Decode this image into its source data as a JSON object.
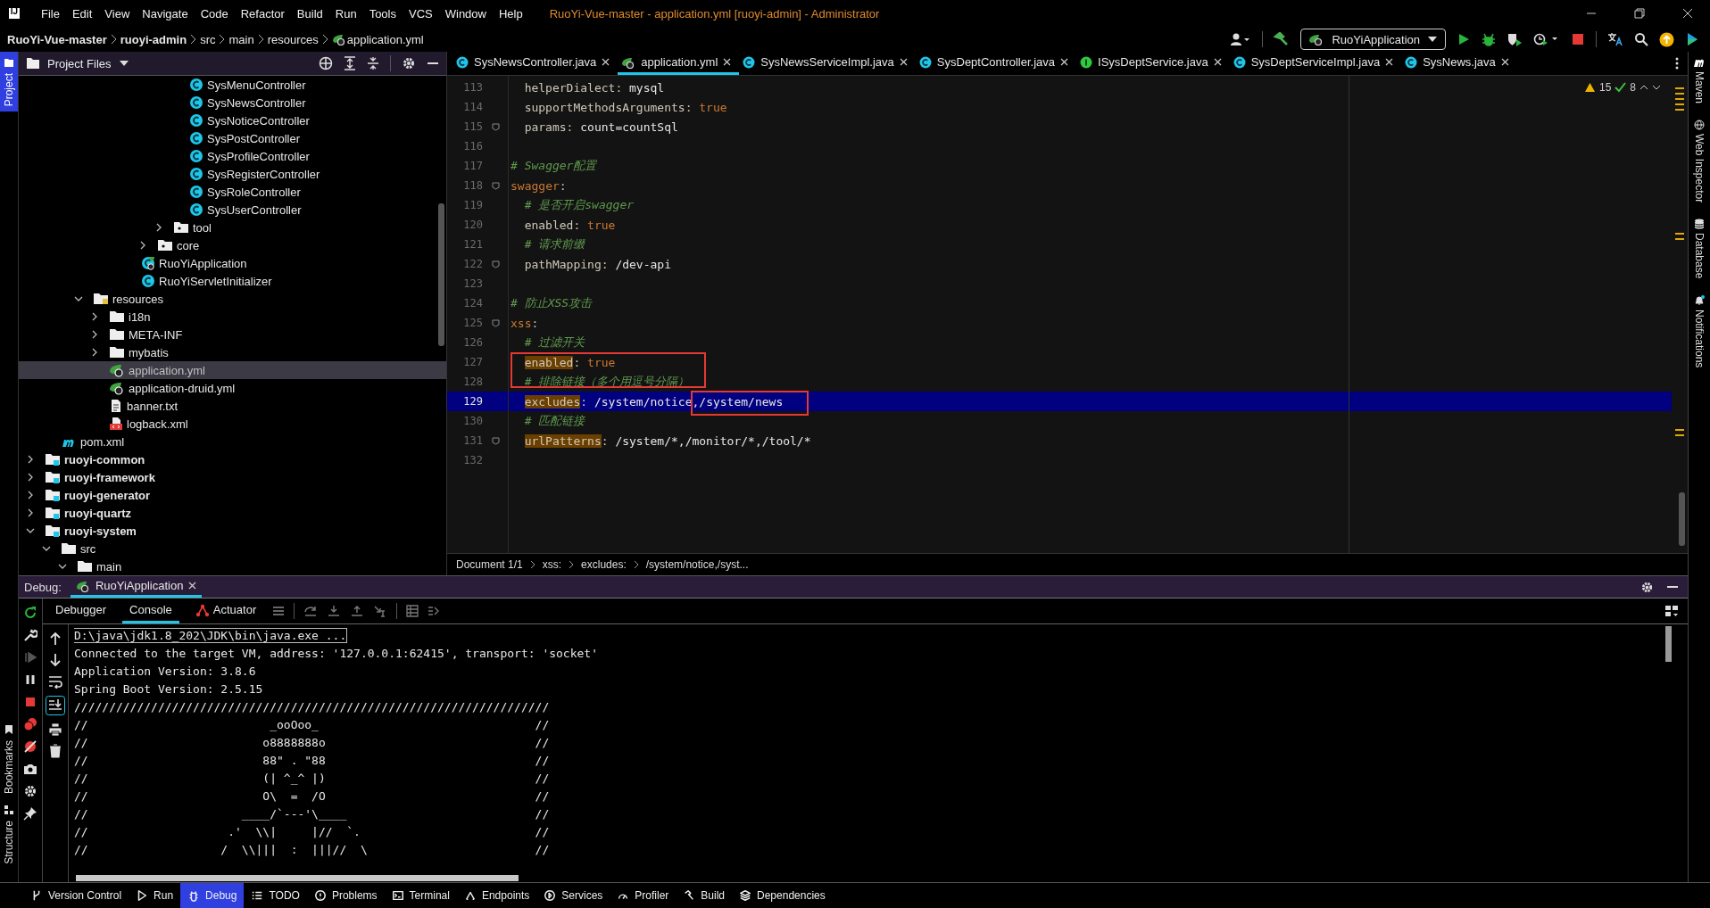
{
  "window": {
    "logo": "IJ",
    "title": "RuoYi-Vue-master - application.yml [ruoyi-admin] - Administrator"
  },
  "menu": [
    "File",
    "Edit",
    "View",
    "Navigate",
    "Code",
    "Refactor",
    "Build",
    "Run",
    "Tools",
    "VCS",
    "Window",
    "Help"
  ],
  "breadcrumbs": [
    {
      "label": "RuoYi-Vue-master",
      "kind": "project"
    },
    {
      "label": "ruoyi-admin",
      "kind": "project"
    },
    {
      "label": "src",
      "kind": "folder"
    },
    {
      "label": "main",
      "kind": "folder"
    },
    {
      "label": "resources",
      "kind": "folder"
    },
    {
      "label": "application.yml",
      "kind": "yml"
    }
  ],
  "run_config": "RuoYiApplication",
  "side_left": [
    {
      "label": "Project",
      "selected": true
    },
    {
      "label": "Bookmarks",
      "selected": false
    },
    {
      "label": "Structure",
      "selected": false
    }
  ],
  "side_right": [
    "Maven",
    "Web Inspector",
    "Database",
    "Notifications"
  ],
  "project_panel": {
    "title": "Project Files"
  },
  "tree": [
    {
      "children": [
        {
          "children": [
            {
              "children": [
                {
                  "children": [
                    {
                      "children": [
                        {
                          "children": [
                            {
                              "children": [
                                {
                                  "children": [
                                    {
                                      "children": [
                                        {
                                          "label": "SysMenuController",
                                          "kind": "class",
                                          "selected": false
                                        },
                                        {
                                          "label": "SysNewsController",
                                          "kind": "class",
                                          "selected": false
                                        },
                                        {
                                          "label": "SysNoticeController",
                                          "kind": "class",
                                          "selected": false
                                        },
                                        {
                                          "label": "SysPostController",
                                          "kind": "class",
                                          "selected": false
                                        },
                                        {
                                          "label": "SysProfileController",
                                          "kind": "class",
                                          "selected": false
                                        },
                                        {
                                          "label": "SysRegisterController",
                                          "kind": "class",
                                          "selected": false
                                        },
                                        {
                                          "label": "SysRoleController",
                                          "kind": "class",
                                          "selected": false
                                        },
                                        {
                                          "label": "SysUserController",
                                          "kind": "class",
                                          "selected": false
                                        }
                                      ]
                                    },
                                    {
                                      "label": "tool",
                                      "kind": "folder",
                                      "expanded": false,
                                      "selected": false
                                    }
                                  ]
                                },
                                {
                                  "label": "core",
                                  "kind": "folder",
                                  "expanded": false,
                                  "selected": false
                                }
                              ]
                            },
                            {
                              "label": "RuoYiApplication",
                              "kind": "app-class",
                              "selected": false
                            },
                            {
                              "label": "RuoYiServletInitializer",
                              "kind": "class",
                              "selected": false
                            }
                          ]
                        }
                      ]
                    }
                  ]
                },
                {
                  "label": "resources",
                  "kind": "resource-folder",
                  "expanded": true,
                  "selected": false,
                  "children": [
                    {
                      "label": "i18n",
                      "kind": "folder",
                      "expanded": false,
                      "selected": false
                    },
                    {
                      "label": "META-INF",
                      "kind": "folder",
                      "expanded": false,
                      "selected": false
                    },
                    {
                      "label": "mybatis",
                      "kind": "folder",
                      "expanded": false,
                      "selected": false
                    },
                    {
                      "label": "application.yml",
                      "kind": "yml",
                      "selected": true
                    },
                    {
                      "label": "application-druid.yml",
                      "kind": "yml",
                      "selected": false
                    },
                    {
                      "label": "banner.txt",
                      "kind": "text",
                      "selected": false
                    },
                    {
                      "label": "logback.xml",
                      "kind": "xml",
                      "selected": false
                    }
                  ]
                }
              ]
            }
          ]
        },
        {
          "label": "pom.xml",
          "kind": "maven",
          "selected": false
        }
      ]
    },
    {
      "label": "ruoyi-common",
      "kind": "module",
      "expanded": false,
      "selected": false
    },
    {
      "label": "ruoyi-framework",
      "kind": "module",
      "expanded": false,
      "selected": false
    },
    {
      "label": "ruoyi-generator",
      "kind": "module",
      "expanded": false,
      "selected": false
    },
    {
      "label": "ruoyi-quartz",
      "kind": "module",
      "expanded": false,
      "selected": false
    },
    {
      "label": "ruoyi-system",
      "kind": "module",
      "expanded": true,
      "selected": false,
      "children": [
        {
          "label": "src",
          "kind": "folder",
          "expanded": true,
          "selected": false,
          "children": [
            {
              "label": "main",
              "kind": "folder",
              "expanded": true,
              "selected": false
            }
          ]
        }
      ]
    }
  ],
  "editor_tabs": [
    {
      "label": "SysNewsController.java",
      "kind": "class",
      "selected": false
    },
    {
      "label": "application.yml",
      "kind": "yml",
      "selected": true
    },
    {
      "label": "SysNewsServiceImpl.java",
      "kind": "class",
      "selected": false
    },
    {
      "label": "SysDeptController.java",
      "kind": "class",
      "selected": false
    },
    {
      "label": "ISysDeptService.java",
      "kind": "interface",
      "selected": false
    },
    {
      "label": "SysDeptServiceImpl.java",
      "kind": "class",
      "selected": false
    },
    {
      "label": "SysNews.java",
      "kind": "class",
      "selected": false
    }
  ],
  "inspections": {
    "warnings": "15",
    "ok": "8"
  },
  "code": [
    {
      "number": "113",
      "kind": "pair",
      "key": "helperDialect",
      "sep": ":",
      "value": "mysql",
      "highlighted": false,
      "current": false,
      "fold": false
    },
    {
      "number": "114",
      "kind": "flag",
      "key": "supportMethodsArguments",
      "sep": ":",
      "value": "true",
      "highlighted": false,
      "current": false,
      "fold": false
    },
    {
      "number": "115",
      "kind": "pair",
      "key": "params",
      "sep": ":",
      "value": "count=countSql",
      "highlighted": false,
      "current": false,
      "fold": true
    },
    {
      "number": "116",
      "kind": "blank",
      "current": false,
      "fold": false
    },
    {
      "number": "117",
      "kind": "top-comment",
      "text": "# Swagger配置",
      "highlighted": false,
      "current": false,
      "fold": false
    },
    {
      "number": "118",
      "kind": "section",
      "key": "swagger",
      "sep": ":",
      "highlighted": false,
      "current": false,
      "fold": true
    },
    {
      "number": "119",
      "kind": "comment",
      "text": "# 是否开启swagger",
      "highlighted": false,
      "current": false,
      "fold": false
    },
    {
      "number": "120",
      "kind": "flag",
      "key": "enabled",
      "sep": ":",
      "value": "true",
      "highlighted": false,
      "current": false,
      "fold": false
    },
    {
      "number": "121",
      "kind": "comment",
      "text": "# 请求前缀",
      "highlighted": false,
      "current": false,
      "fold": false
    },
    {
      "number": "122",
      "kind": "pair",
      "key": "pathMapping",
      "sep": ":",
      "value": "/dev-api",
      "highlighted": false,
      "current": false,
      "fold": true
    },
    {
      "number": "123",
      "kind": "blank",
      "current": false,
      "fold": false
    },
    {
      "number": "124",
      "kind": "top-comment",
      "text": "# 防止XSS攻击",
      "highlighted": false,
      "current": false,
      "fold": false
    },
    {
      "number": "125",
      "kind": "section",
      "key": "xss",
      "sep": ":",
      "highlighted": false,
      "current": false,
      "fold": true
    },
    {
      "number": "126",
      "kind": "comment",
      "text": "# 过滤开关",
      "highlighted": false,
      "current": false,
      "fold": false
    },
    {
      "number": "127",
      "kind": "flag",
      "key": "enabled",
      "sep": ":",
      "value": "true",
      "highlighted": true,
      "current": false,
      "fold": false
    },
    {
      "number": "128",
      "kind": "comment",
      "text": "# 排除链接（多个用逗号分隔）",
      "highlighted": false,
      "current": false,
      "fold": false
    },
    {
      "number": "129",
      "kind": "pair",
      "key": "excludes",
      "sep": ":",
      "value": "/system/notice,/system/news",
      "highlighted": true,
      "current": true,
      "fold": false
    },
    {
      "number": "130",
      "kind": "comment",
      "text": "# 匹配链接",
      "highlighted": false,
      "current": false,
      "fold": false
    },
    {
      "number": "131",
      "kind": "pair",
      "key": "urlPatterns",
      "sep": ":",
      "value": "/system/*,/monitor/*,/tool/*",
      "highlighted": true,
      "current": false,
      "fold": true
    },
    {
      "number": "132",
      "kind": "blank",
      "current": false,
      "fold": false
    }
  ],
  "editor_breadcrumb": [
    "Document 1/1",
    "xss:",
    "excludes:",
    "/system/notice,/syst..."
  ],
  "debug": {
    "label": "Debug:",
    "session": "RuoYiApplication",
    "tabs": [
      {
        "label": "Debugger",
        "selected": false
      },
      {
        "label": "Console",
        "selected": true
      },
      {
        "label": "Actuator",
        "selected": false
      }
    ],
    "console": [
      {
        "text": "D:\\java\\jdk1.8_202\\JDK\\bin\\java.exe ...",
        "boxed": true
      },
      {
        "text": "Connected to the target VM, address: '127.0.0.1:62415', transport: 'socket'",
        "boxed": false
      },
      {
        "text": "Application Version: 3.8.6",
        "boxed": false
      },
      {
        "text": "Spring Boot Version: 2.5.15",
        "boxed": false
      },
      {
        "text": "////////////////////////////////////////////////////////////////////",
        "boxed": false
      },
      {
        "text": "//                          _ooOoo_                               //",
        "boxed": false
      },
      {
        "text": "//                         o8888888o                              //",
        "boxed": false
      },
      {
        "text": "//                         88\" . \"88                              //",
        "boxed": false
      },
      {
        "text": "//                         (| ^_^ |)                              //",
        "boxed": false
      },
      {
        "text": "//                         O\\  =  /O                              //",
        "boxed": false
      },
      {
        "text": "//                      ____/`---'\\____                           //",
        "boxed": false
      },
      {
        "text": "//                    .'  \\\\|     |//  `.                         //",
        "boxed": false
      },
      {
        "text": "//                   /  \\\\|||  :  |||//  \\                        //",
        "boxed": false
      }
    ]
  },
  "status_bar": [
    {
      "label": "Version Control",
      "selected": false
    },
    {
      "label": "Run",
      "selected": false
    },
    {
      "label": "Debug",
      "selected": true
    },
    {
      "label": "TODO",
      "selected": false
    },
    {
      "label": "Problems",
      "selected": false
    },
    {
      "label": "Terminal",
      "selected": false
    },
    {
      "label": "Endpoints",
      "selected": false
    },
    {
      "label": "Services",
      "selected": false
    },
    {
      "label": "Profiler",
      "selected": false
    },
    {
      "label": "Build",
      "selected": false
    },
    {
      "label": "Dependencies",
      "selected": false
    }
  ]
}
